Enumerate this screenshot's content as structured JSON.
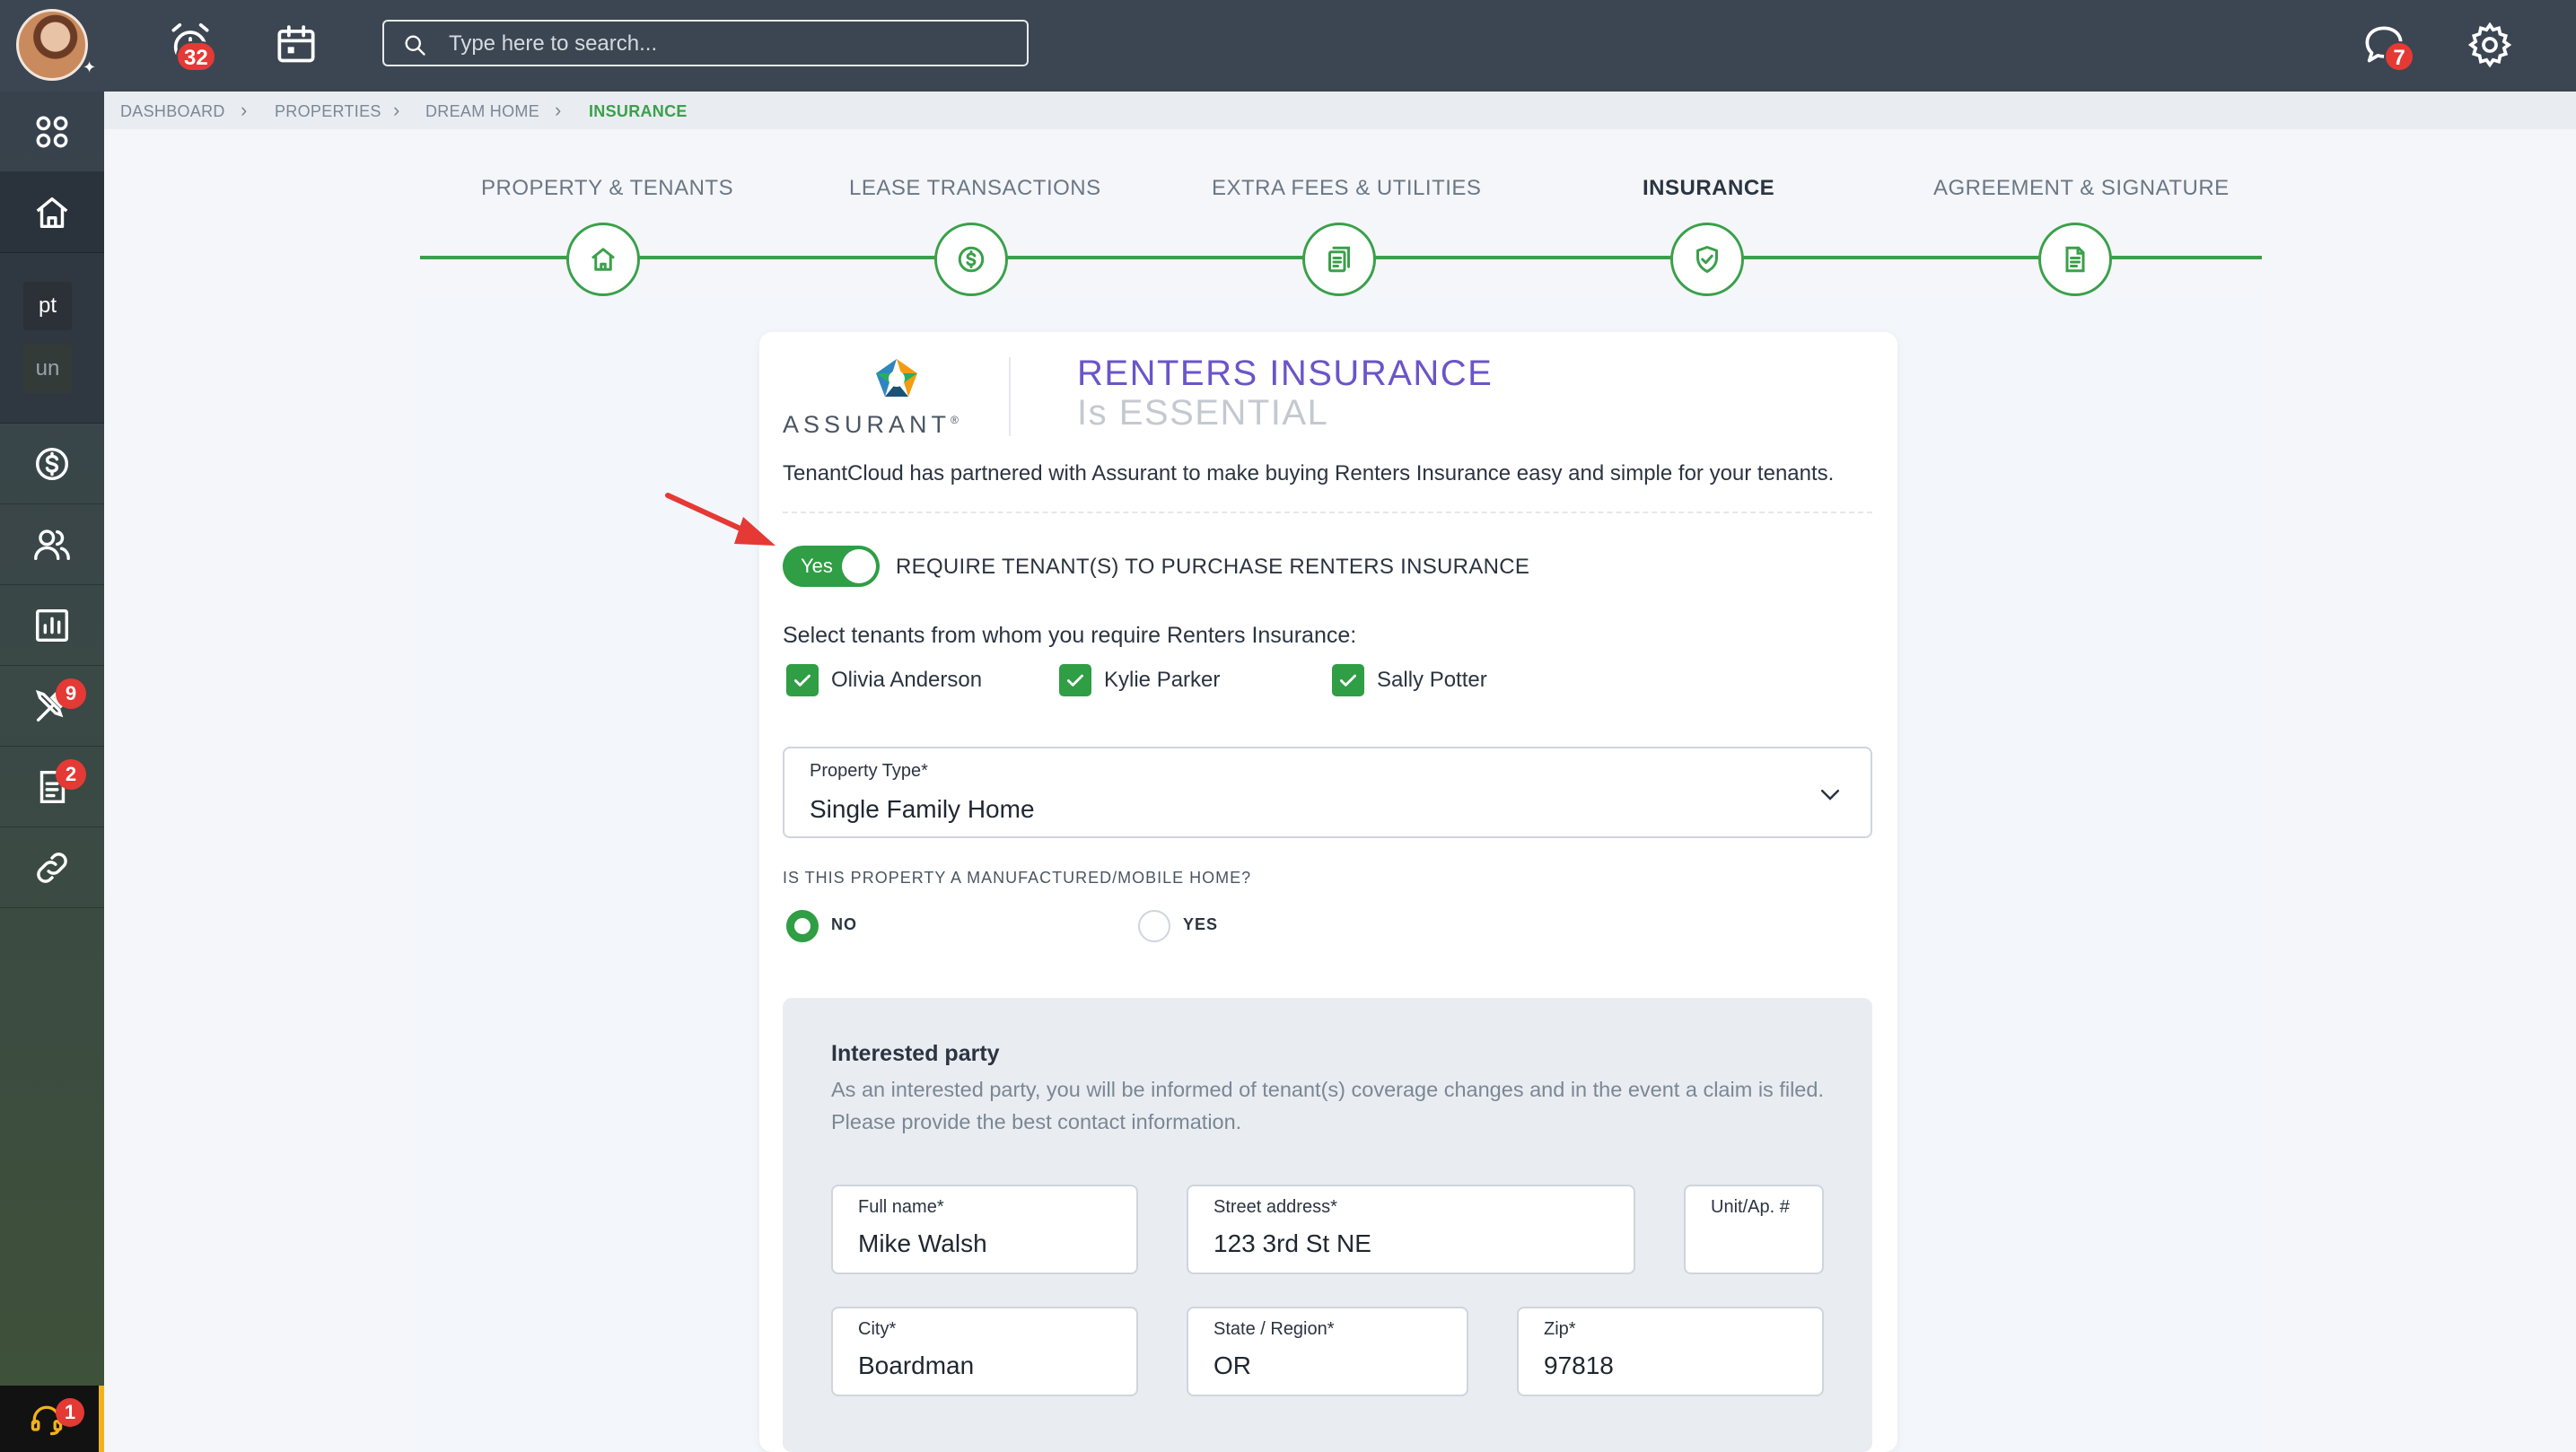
{
  "topbar": {
    "notifications_count": "32",
    "messages_count": "7",
    "search": {
      "placeholder": "Type here to search..."
    }
  },
  "sidebar": {
    "chip_1": "pt",
    "chip_2": "un",
    "maintenance_badge": "9",
    "documents_badge": "2",
    "support_badge": "1"
  },
  "breadcrumb": {
    "items": [
      "DASHBOARD",
      "PROPERTIES",
      "DREAM HOME",
      "INSURANCE"
    ]
  },
  "steps": [
    {
      "label": "PROPERTY & TENANTS",
      "icon": "home-icon"
    },
    {
      "label": "LEASE TRANSACTIONS",
      "icon": "dollar-icon"
    },
    {
      "label": "EXTRA FEES & UTILITIES",
      "icon": "receipt-icon"
    },
    {
      "label": "INSURANCE",
      "icon": "shield-check-icon",
      "active": true
    },
    {
      "label": "AGREEMENT & SIGNATURE",
      "icon": "document-icon"
    }
  ],
  "insurance": {
    "brand": "ASSURANT",
    "brand_mark": "®",
    "title": "RENTERS INSURANCE",
    "subtitle": "Is ESSENTIAL",
    "intro": "TenantCloud has partnered with Assurant to make buying Renters Insurance easy and simple for your tenants.",
    "toggle_label": "Yes",
    "require_label": "REQUIRE TENANT(S) TO PURCHASE RENTERS INSURANCE",
    "select_tenants_label": "Select tenants from whom you require Renters Insurance:",
    "tenants": [
      "Olivia Anderson",
      "Kylie Parker",
      "Sally Potter"
    ],
    "property_type_label": "Property Type*",
    "property_type_value": "Single Family Home",
    "manufactured_label": "IS THIS PROPERTY A MANUFACTURED/MOBILE HOME?",
    "manufactured_options": [
      "NO",
      "YES"
    ],
    "manufactured_selected": "NO"
  },
  "interested_party": {
    "title": "Interested party",
    "description": "As an interested party, you will be informed of tenant(s) coverage changes and in the event a claim is filed. Please provide the best contact information.",
    "fields": {
      "full_name": {
        "label": "Full name*",
        "value": "Mike Walsh"
      },
      "street": {
        "label": "Street address*",
        "value": "123 3rd St NE"
      },
      "unit": {
        "label": "Unit/Ap. #",
        "value": ""
      },
      "city": {
        "label": "City*",
        "value": "Boardman"
      },
      "state": {
        "label": "State / Region*",
        "value": "OR"
      },
      "zip": {
        "label": "Zip*",
        "value": "97818"
      }
    }
  },
  "colors": {
    "accent_green": "#2f9e44",
    "title_purple": "#6a55c9",
    "badge_red": "#e53935",
    "topbar": "#3c4652"
  }
}
